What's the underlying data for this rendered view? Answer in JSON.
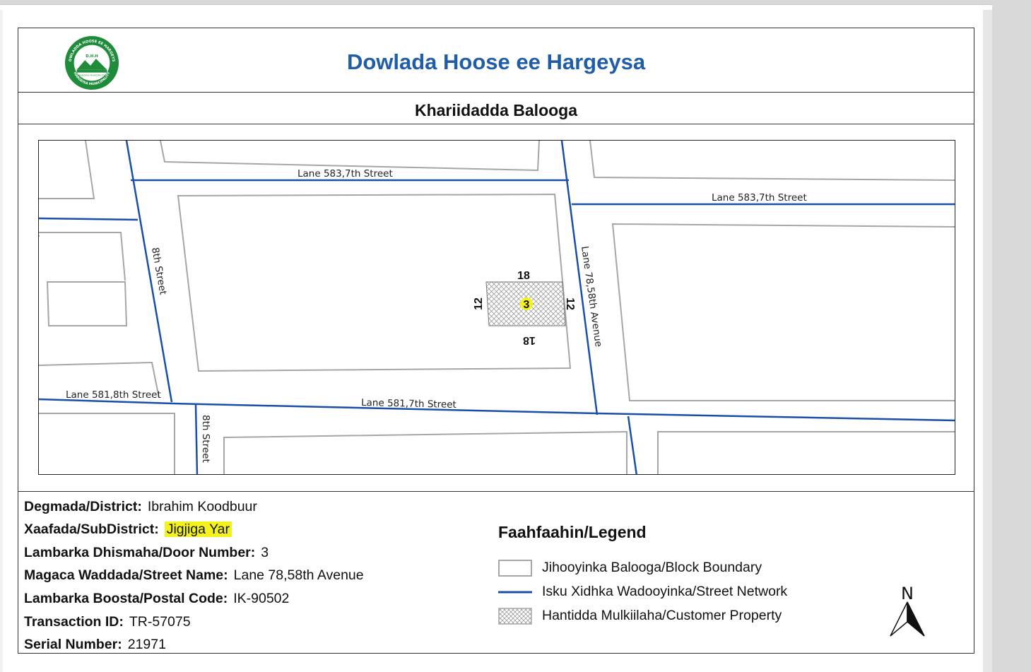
{
  "header": {
    "title": "Dowlada Hoose ee Hargeysa",
    "subtitle": "Khariidadda Balooga",
    "logo": {
      "ring_text_top": "DOWLADDA HOOSE EE HARGEYSA",
      "ring_text_bottom": "HARGEISA MUNICIPALITY",
      "initials": "D.H.H",
      "band_text": "HARGEISA MUNICIPALITY",
      "color": "#1e8c3a"
    }
  },
  "map": {
    "street_labels": {
      "lane583_a": "Lane 583,7th Street",
      "lane583_b": "Lane 583,7th Street",
      "lane581_a": "Lane 581,8th Street",
      "lane581_b": "Lane 581,7th Street",
      "eighth_a": "8th Street",
      "eighth_b": "8th Street",
      "avenue": "Lane 78,58th Avenue"
    },
    "parcel": {
      "number": "3",
      "dim_top": "18",
      "dim_bottom": "18",
      "dim_left": "12",
      "dim_right": "12"
    },
    "colors": {
      "street": "#1a4fa8",
      "block": "#a6a6a6",
      "highlight": "#f4f21c"
    }
  },
  "info": {
    "district": {
      "label": "Degmada/District:",
      "value": "Ibrahim Koodbuur"
    },
    "subdistrict": {
      "label": "Xaafada/SubDistrict:",
      "value": "Jigjiga Yar"
    },
    "door": {
      "label": "Lambarka Dhismaha/Door Number:",
      "value": "3"
    },
    "street": {
      "label": "Magaca Waddada/Street Name:",
      "value": "Lane 78,58th Avenue"
    },
    "postal": {
      "label": "Lambarka Boosta/Postal Code:",
      "value": "IK-90502"
    },
    "transaction": {
      "label": "Transaction ID:",
      "value": "TR-57075"
    },
    "serial": {
      "label": "Serial Number:",
      "value": "21971"
    }
  },
  "legend": {
    "title": "Faahfaahin/Legend",
    "items": [
      {
        "label": "Jihooyinka Balooga/Block Boundary",
        "icon": "block-boundary-swatch"
      },
      {
        "label": "Isku Xidhka Wadooyinka/Street Network",
        "icon": "street-line-swatch"
      },
      {
        "label": "Hantidda Mulkiilaha/Customer Property",
        "icon": "hatched-property-swatch"
      }
    ]
  },
  "north_arrow": {
    "label": "N",
    "icon": "north-arrow-icon"
  }
}
